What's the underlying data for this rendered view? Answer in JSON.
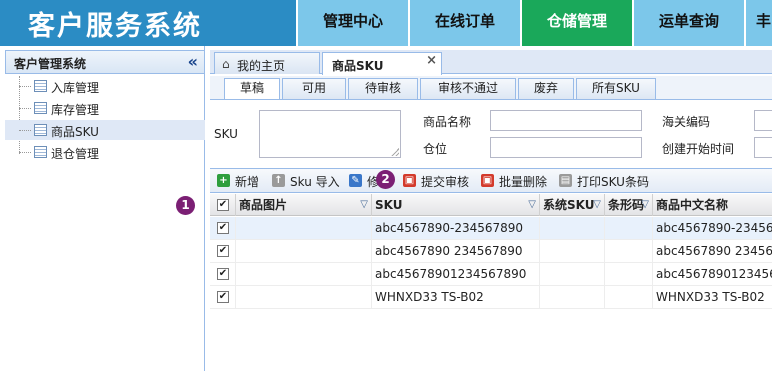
{
  "header": {
    "app_title": "客户服务系统",
    "tabs": [
      {
        "label": "管理中心"
      },
      {
        "label": "在线订单"
      },
      {
        "label": "仓储管理"
      },
      {
        "label": "运单查询"
      },
      {
        "label": "丰"
      }
    ],
    "active_tab": "仓储管理"
  },
  "sidebar": {
    "title": "客户管理系统",
    "collapse_icon": "«",
    "items": [
      {
        "label": "入库管理"
      },
      {
        "label": "库存管理"
      },
      {
        "label": "商品SKU"
      },
      {
        "label": "退仓管理"
      }
    ],
    "active_item": "商品SKU"
  },
  "page_tabs": [
    {
      "label": "我的主页",
      "icon": "home-icon"
    },
    {
      "label": "商品SKU",
      "icon": "close-icon"
    }
  ],
  "status_tabs": [
    "草稿",
    "可用",
    "待审核",
    "审核不通过",
    "废弃",
    "所有SKU"
  ],
  "active_status": "草稿",
  "search": {
    "sku_label": "SKU",
    "name_label": "商品名称",
    "customs_label": "海关编码",
    "location_label": "仓位",
    "created_label": "创建开始时间"
  },
  "toolbar": {
    "add_label": "新增",
    "import_label": "Sku 导入",
    "edit_label": "修",
    "submit_label": "提交审核",
    "batch_delete_label": "批量删除",
    "print_label": "打印SKU条码"
  },
  "grid": {
    "columns": [
      "商品图片",
      "SKU",
      "系统SKU",
      "条形码",
      "商品中文名称"
    ],
    "rows": [
      {
        "sku": "abc4567890-234567890",
        "name": "abc4567890-2345678"
      },
      {
        "sku": "abc4567890 234567890",
        "name": "abc4567890 2345678"
      },
      {
        "sku": "abc45678901234567890",
        "name": "abc45678901234567"
      },
      {
        "sku": "WHNXD33 TS-B02",
        "name": "WHNXD33 TS-B02"
      }
    ]
  },
  "callouts": [
    "1",
    "2"
  ],
  "colors": {
    "header_bg": "#2b8cc4",
    "tab_bg": "#7cc7ea",
    "tab_active_bg": "#1aa85a",
    "badge": "#7b1f74"
  }
}
